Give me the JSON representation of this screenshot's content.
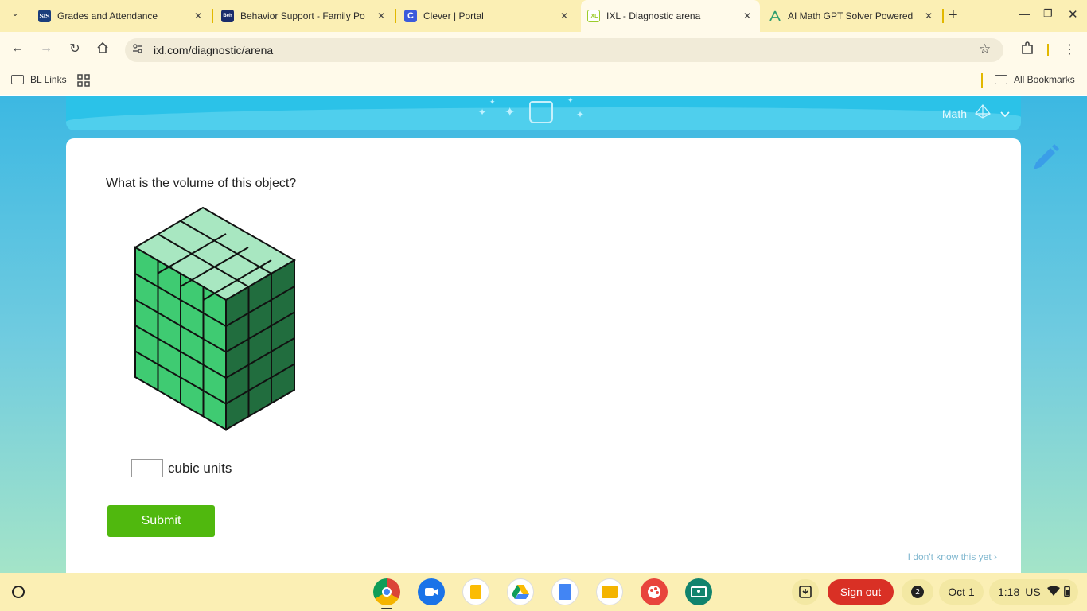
{
  "browser": {
    "tabs": [
      {
        "title": "Grades and Attendance",
        "favicon": "SIS",
        "color": "#1a3d7c"
      },
      {
        "title": "Behavior Support - Family Po",
        "favicon": "Beh",
        "color": "#1a2c6b"
      },
      {
        "title": "Clever | Portal",
        "favicon": "C",
        "color": "#3b5bdb"
      },
      {
        "title": "IXL - Diagnostic arena",
        "favicon": "IXL",
        "color": "#9ccc2a",
        "active": true
      },
      {
        "title": "AI Math GPT Solver Powered",
        "favicon": "math-solver-icon",
        "color": "#2f9e6e"
      }
    ],
    "url": "ixl.com/diagnostic/arena",
    "bookmarks": {
      "left": "BL Links",
      "right": "All Bookmarks"
    }
  },
  "banner": {
    "subject": "Math"
  },
  "question": {
    "prompt": "What is the volume of this object?",
    "unit_label": "cubic units",
    "answer_value": "",
    "submit_label": "Submit",
    "dont_know_label": "I don't know this yet ›"
  },
  "shelf": {
    "apps": [
      "chrome",
      "meet",
      "keep",
      "drive",
      "docs",
      "slides",
      "canvas",
      "classroom"
    ],
    "signout_label": "Sign out",
    "notification_count": "2",
    "date": "Oct 1",
    "time": "1:18",
    "locale": "US"
  },
  "colors": {
    "cube_top": "#a8e7c1",
    "cube_front": "#3fcb72",
    "cube_side": "#216d3e",
    "submit": "#50b80e",
    "signout": "#d93025"
  }
}
